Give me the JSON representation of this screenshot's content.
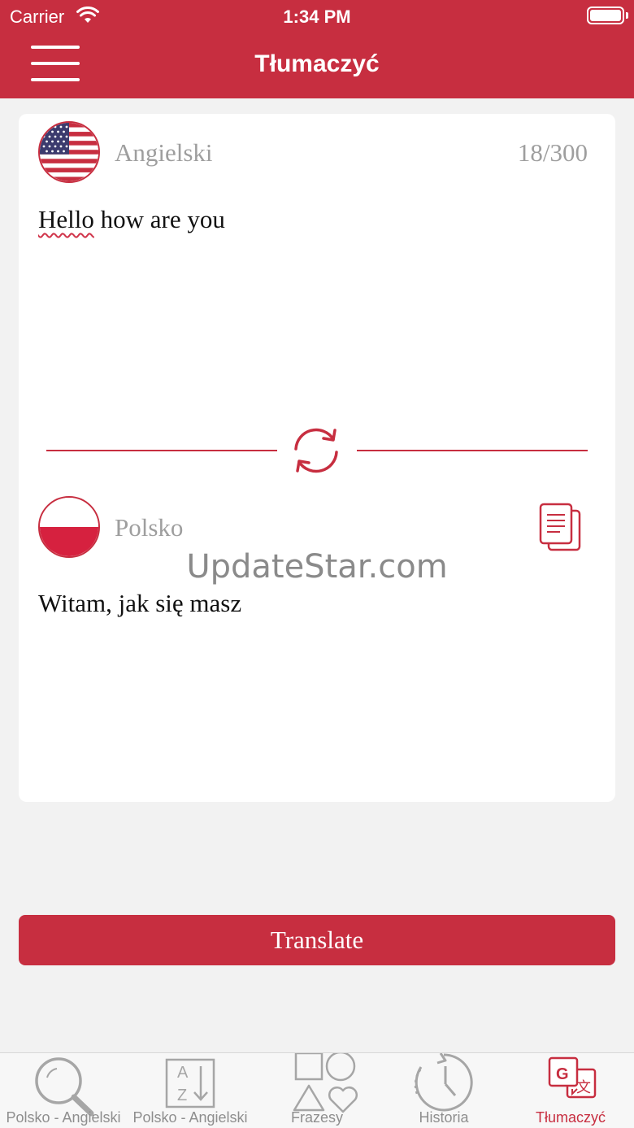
{
  "status": {
    "carrier": "Carrier",
    "time": "1:34 PM"
  },
  "header": {
    "title": "Tłumaczyć"
  },
  "source": {
    "language": "Angielski",
    "counter": "18/300",
    "text_word1": "Hello",
    "text_rest": " how are you"
  },
  "target": {
    "language": "Polsko",
    "text": "Witam, jak się masz"
  },
  "watermark": "UpdateStar.com",
  "translate_button": "Translate",
  "tabs": [
    {
      "label": "Polsko - Angielski",
      "icon": "search-icon"
    },
    {
      "label": "Polsko - Angielski",
      "icon": "sort-az-icon"
    },
    {
      "label": "Frazesy",
      "icon": "shapes-icon"
    },
    {
      "label": "Historia",
      "icon": "history-icon"
    },
    {
      "label": "Tłumaczyć",
      "icon": "translate-icon",
      "active": true
    }
  ],
  "colors": {
    "accent": "#c72e40",
    "background": "#f2f2f2",
    "tab_inactive": "#8e8e8e"
  }
}
